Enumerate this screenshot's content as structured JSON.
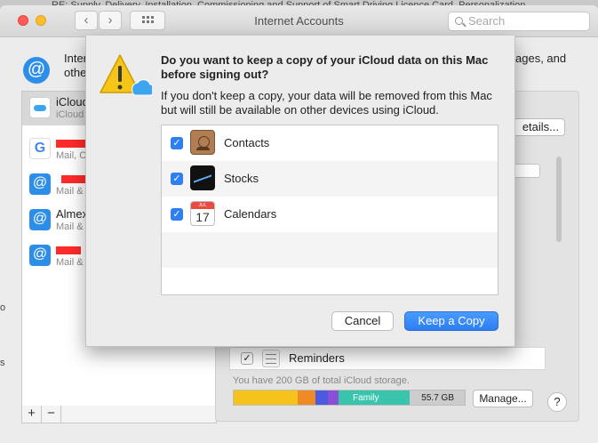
{
  "background_window": {
    "title": "RE: Supply, Delivery, Installation, Commissioning and Support of Smart Driving Licence Card, Personalization"
  },
  "window": {
    "title": "Internet Accounts",
    "search_placeholder": "Search",
    "intro_text_left": "Internet\nother",
    "intro_text_right": "ages, and"
  },
  "accounts": [
    {
      "name": "iCloud",
      "sub": "iCloud",
      "icon": "icloud-icon",
      "selected": true
    },
    {
      "name": "",
      "sub": "Mail, C",
      "icon": "google-icon",
      "redacted": true
    },
    {
      "name": "",
      "sub": "Mail &",
      "icon": "at-icon",
      "redacted": true
    },
    {
      "name": "Almex",
      "sub": "Mail &",
      "icon": "at-icon"
    },
    {
      "name": "",
      "sub": "Mail &",
      "icon": "at-icon",
      "redacted": true
    }
  ],
  "list_controls": {
    "add": "+",
    "remove": "−"
  },
  "detail_pane": {
    "details_button": "etails...",
    "reminders": {
      "label": "Reminders",
      "checked": true
    },
    "storage_text": "You have 200 GB of total iCloud storage.",
    "storage_bar": {
      "family_label": "Family",
      "size_label": "55.7 GB"
    },
    "manage_button": "Manage...",
    "help_button": "?"
  },
  "edge_text": {
    "o": "o",
    "s": "s"
  },
  "dialog": {
    "title": "Do you want to keep a copy of your iCloud data on this Mac before signing out?",
    "body": "If you don't keep a copy, your data will be removed from this Mac but will still be available on other devices using iCloud.",
    "items": [
      {
        "label": "Contacts",
        "checked": true,
        "icon": "contacts-icon"
      },
      {
        "label": "Stocks",
        "checked": true,
        "icon": "stocks-icon"
      },
      {
        "label": "Calendars",
        "checked": true,
        "icon": "calendar-icon",
        "icon_month": "JUL",
        "icon_day": "17"
      }
    ],
    "cancel_button": "Cancel",
    "keep_button": "Keep a Copy"
  },
  "colors": {
    "accent": "#2f7ff0",
    "warning": "#f5c518",
    "icloud": "#3ea4ef"
  }
}
